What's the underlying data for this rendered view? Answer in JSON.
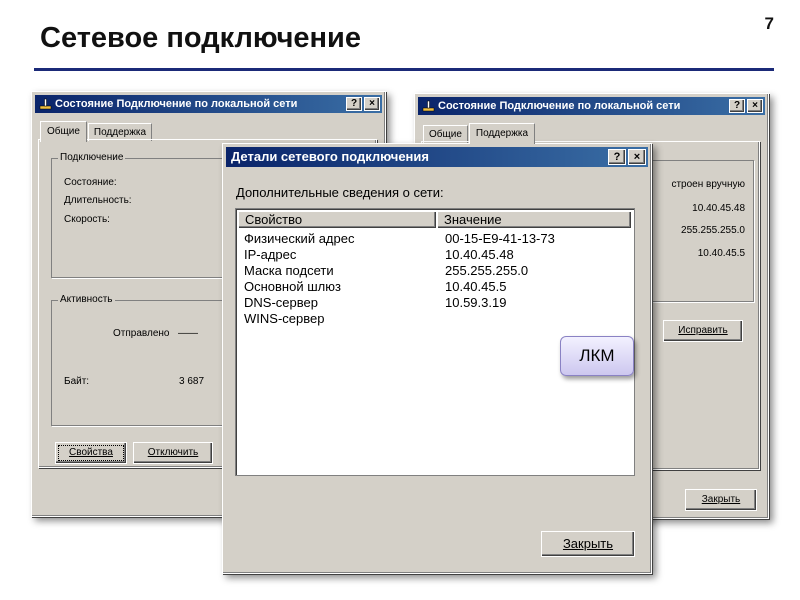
{
  "slide": {
    "title": "Сетевое подключение",
    "number": "7"
  },
  "window_general": {
    "title": "Состояние Подключение по локальной сети",
    "tabs": [
      "Общие",
      "Поддержка"
    ],
    "connection_group": "Подключение",
    "status_label": "Состояние:",
    "duration_label": "Длительность:",
    "speed_label": "Скорость:",
    "activity_group": "Активность",
    "sent_label": "Отправлено",
    "sent_dash": "——",
    "bytes_label": "Байт:",
    "bytes_value": "3 687",
    "properties_button": "Свойства",
    "disconnect_button": "Отключить"
  },
  "window_support": {
    "title": "Состояние Подключение по локальной сети",
    "tabs": [
      "Общие",
      "Поддержка"
    ],
    "assign_text": "строен вручную",
    "ip_value": "10.40.45.48",
    "mask_value": "255.255.255.0",
    "gateway_value": "10.40.45.5",
    "repair_button": "Исправить",
    "close_button": "Закрыть"
  },
  "dialog": {
    "title": "Детали сетевого подключения",
    "subtitle": "Дополнительные сведения о сети:",
    "columns": [
      "Свойство",
      "Значение"
    ],
    "rows": [
      {
        "property": "Физический адрес",
        "value": "00-15-E9-41-13-73"
      },
      {
        "property": "IP-адрес",
        "value": "10.40.45.48"
      },
      {
        "property": "Маска подсети",
        "value": "255.255.255.0"
      },
      {
        "property": "Основной шлюз",
        "value": "10.40.45.5"
      },
      {
        "property": "DNS-сервер",
        "value": "10.59.3.19"
      },
      {
        "property": "WINS-сервер",
        "value": ""
      }
    ],
    "close_button": "Закрыть"
  },
  "titlebar_buttons": {
    "help": "?",
    "close": "×"
  },
  "callout": {
    "text": "ЛКМ"
  },
  "colors": {
    "title_rule": "#1b2a78",
    "titlebar": "#0a246a",
    "window_face": "#d4d0c8"
  }
}
